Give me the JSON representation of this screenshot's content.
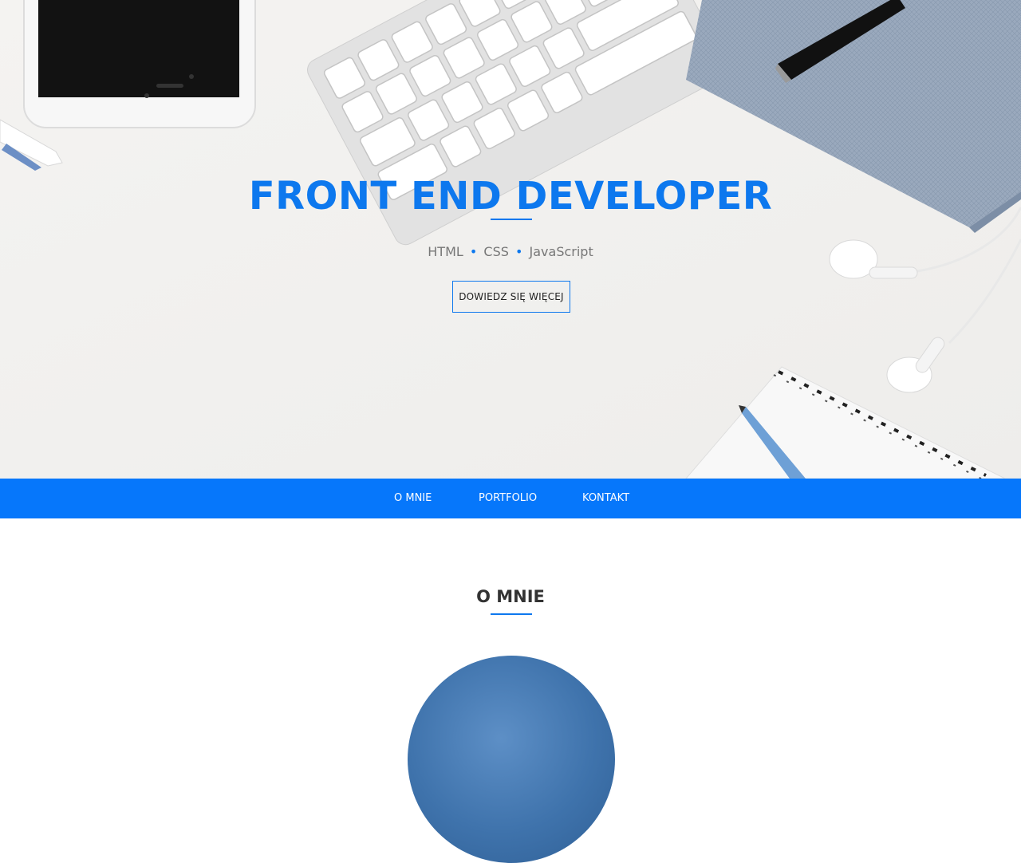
{
  "hero": {
    "title": "FRONT END DEVELOPER",
    "subtitle": {
      "items": [
        "HTML",
        "CSS",
        "JavaScript"
      ],
      "separator": "•"
    },
    "cta_label": "DOWIEDZ SIĘ WIĘCEJ"
  },
  "nav": {
    "items": [
      {
        "label": "O MNIE"
      },
      {
        "label": "PORTFOLIO"
      },
      {
        "label": "KONTAKT"
      }
    ]
  },
  "about": {
    "title": "O MNIE"
  },
  "colors": {
    "accent": "#0d78ee",
    "nav_bg": "#0677fb",
    "hero_bg": "#f2f1ef"
  }
}
